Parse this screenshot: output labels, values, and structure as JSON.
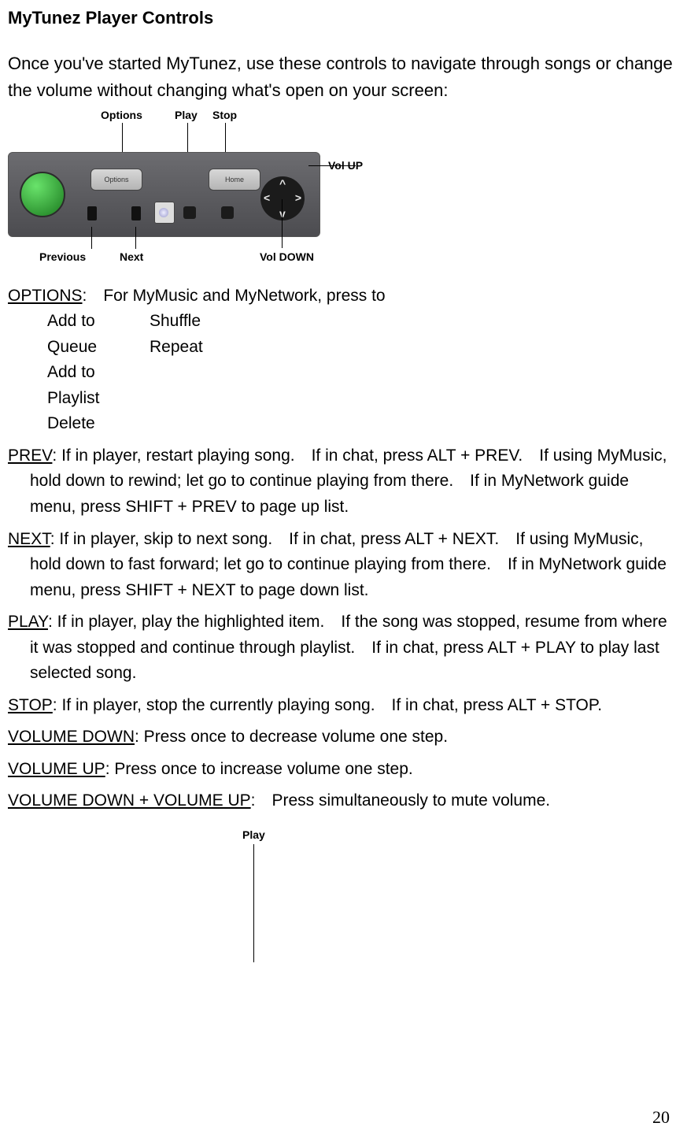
{
  "title": "MyTunez Player Controls",
  "intro": "Once you've started MyTunez, use these controls to navigate through songs or change the volume without changing what's open on your screen:",
  "diagram": {
    "top": {
      "options": "Options",
      "play": "Play",
      "stop": "Stop"
    },
    "side": {
      "vol_up": "Vol UP",
      "vol_down": "Vol DOWN",
      "previous": "Previous",
      "next": "Next"
    },
    "pills": {
      "options": "Options",
      "home": "Home"
    },
    "dpad": {
      "up": "^",
      "down": "v",
      "left": "<",
      "right": ">"
    }
  },
  "options": {
    "label": "OPTIONS",
    "tail": ": For MyMusic and MyNetwork, press to",
    "col1_a": "Add to Queue",
    "col1_b": "Add to Playlist",
    "col1_c": "Delete",
    "col2_a": "Shuffle",
    "col2_b": "Repeat"
  },
  "entries": {
    "prev": {
      "label": "PREV",
      "text": ": If in player, restart playing song. If in chat, press ALT + PREV. If using MyMusic, hold down to rewind; let go to continue playing from there. If in MyNetwork guide menu, press SHIFT + PREV to page up list."
    },
    "next": {
      "label": "NEXT",
      "text": ": If in player, skip to next song. If in chat, press ALT + NEXT. If using MyMusic, hold down to fast forward; let go to continue playing from there. If in MyNetwork guide menu, press SHIFT + NEXT to page down list."
    },
    "play": {
      "label": "PLAY",
      "text": ": If in player, play the highlighted item. If the song was stopped, resume from where it was stopped and continue through playlist. If in chat, press ALT + PLAY to play last selected song."
    },
    "stop": {
      "label": "STOP",
      "text": ": If in player, stop the currently playing song. If in chat, press ALT + STOP."
    },
    "voldn": {
      "label": "VOLUME DOWN",
      "text": ": Press once to decrease volume one step."
    },
    "volup": {
      "label": "VOLUME UP",
      "text": ": Press once to increase volume one step."
    },
    "mute": {
      "label": "VOLUME DOWN + VOLUME UP",
      "text": ": Press simultaneously to mute volume."
    }
  },
  "bottom_play": "Play",
  "page_number": "20"
}
